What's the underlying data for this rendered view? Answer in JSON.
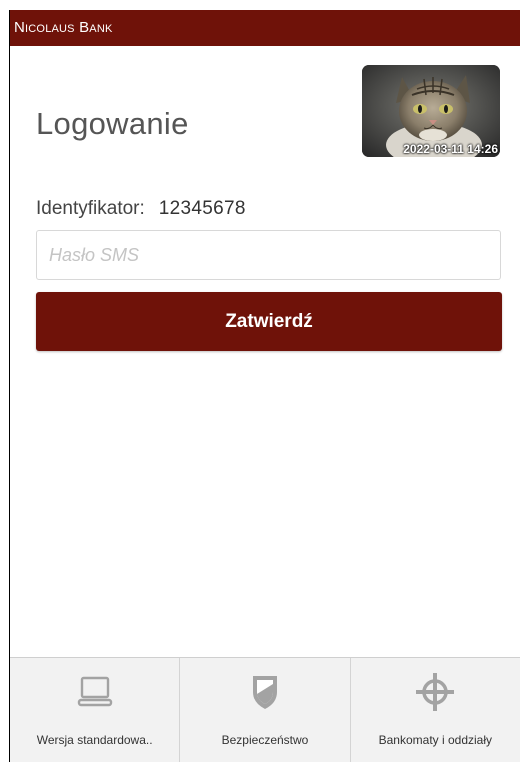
{
  "header": {
    "brand": "Nicolaus Bank"
  },
  "login": {
    "title": "Logowanie",
    "photo_timestamp": "2022-03-11 14:26",
    "identifier_label": "Identyfikator:",
    "identifier_value": "12345678",
    "sms_placeholder": "Hasło SMS",
    "sms_value": "",
    "submit_label": "Zatwierdź"
  },
  "tabbar": {
    "items": [
      {
        "label": "Wersja standardowa..",
        "icon": "laptop-icon"
      },
      {
        "label": "Bezpieczeństwo",
        "icon": "shield-icon"
      },
      {
        "label": "Bankomaty i oddziały",
        "icon": "crosshair-icon"
      }
    ]
  },
  "colors": {
    "brand": "#6f1209",
    "tab_background": "#f2f2f2",
    "icon_gray": "#a3a3a3"
  }
}
